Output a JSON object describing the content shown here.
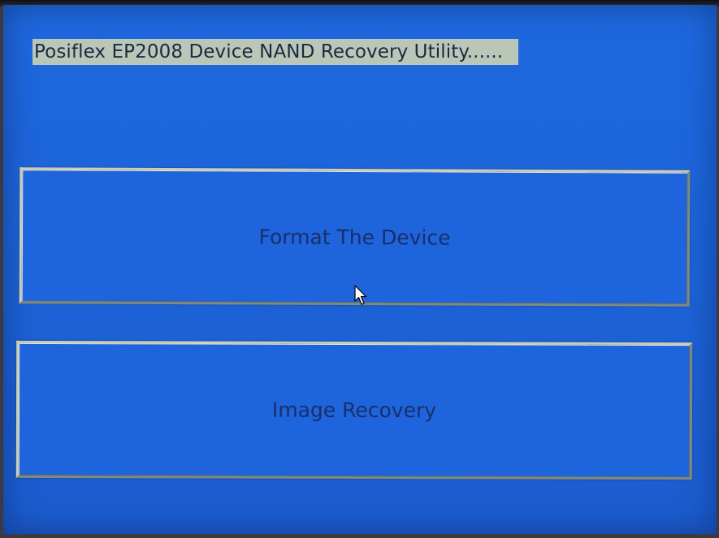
{
  "window": {
    "title": "Posiflex EP2008 Device NAND Recovery Utility......"
  },
  "buttons": {
    "format_label": "Format The Device",
    "recovery_label": "Image Recovery"
  },
  "cursor": {
    "icon": "mouse-pointer-icon"
  },
  "colors": {
    "background": "#1e68de",
    "title_highlight": "#b9c6b8",
    "button_text": "#1a2f6a"
  }
}
